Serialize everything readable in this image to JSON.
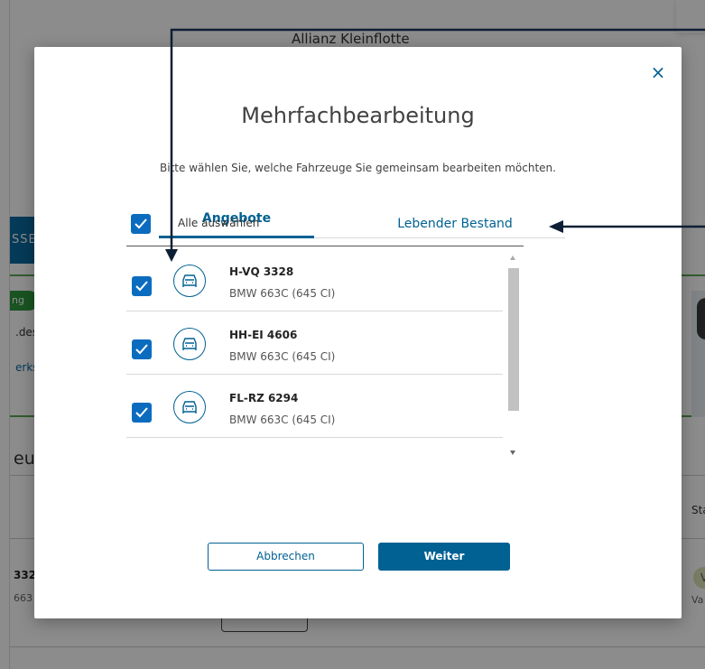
{
  "background": {
    "title": "Allianz Kleinflotte",
    "button_fragment": "SSE",
    "pill_fragment": "ng",
    "text_fragment_1": ".des",
    "link_fragment": "erks",
    "heading_fragment": "eu",
    "column_fragment": "Sta",
    "row_title_fragment": "332",
    "row_sub_fragment": "663",
    "badge_fragment": "V",
    "status_fragment": "Va"
  },
  "modal": {
    "close_label": "×",
    "title": "Mehrfachbearbeitung",
    "subtitle": "Bitte wählen Sie, welche Fahrzeuge Sie gemeinsam bearbeiten möchten.",
    "tabs": [
      {
        "label": "Angebote",
        "active": true
      },
      {
        "label": "Lebender Bestand",
        "active": false
      }
    ],
    "select_all": {
      "label": "Alle auswählen",
      "checked": true
    },
    "vehicles": [
      {
        "plate": "H-VQ 3328",
        "model": "BMW 663C (645 CI)",
        "checked": true,
        "icon": "car-icon"
      },
      {
        "plate": "HH-EI 4606",
        "model": "BMW 663C (645 CI)",
        "checked": true,
        "icon": "car-icon"
      },
      {
        "plate": "FL-RZ 6294",
        "model": "BMW 663C (645 CI)",
        "checked": true,
        "icon": "car-icon"
      }
    ],
    "buttons": {
      "cancel": "Abbrechen",
      "next": "Weiter"
    }
  },
  "colors": {
    "primary": "#006192",
    "checkbox": "#0b6cbf",
    "overlay": "rgba(0,0,0,0.45)"
  }
}
